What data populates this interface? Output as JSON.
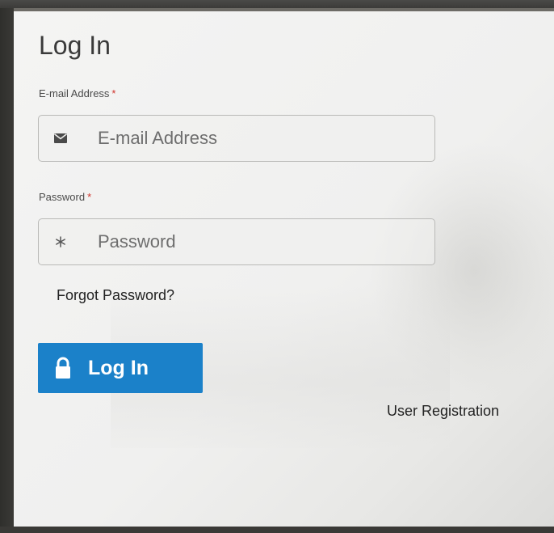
{
  "form": {
    "title": "Log In",
    "email": {
      "label": "E-mail Address",
      "required_marker": "*",
      "placeholder": "E-mail Address",
      "value": "",
      "icon": "envelope-icon"
    },
    "password": {
      "label": "Password",
      "required_marker": "*",
      "placeholder": "Password",
      "value": "",
      "icon": "asterisk-icon"
    },
    "forgot_link": "Forgot Password?",
    "login_button": {
      "label": "Log In",
      "icon": "lock-icon"
    },
    "register_link": "User Registration"
  },
  "colors": {
    "accent": "#1b81c9",
    "required": "#d0342c"
  }
}
